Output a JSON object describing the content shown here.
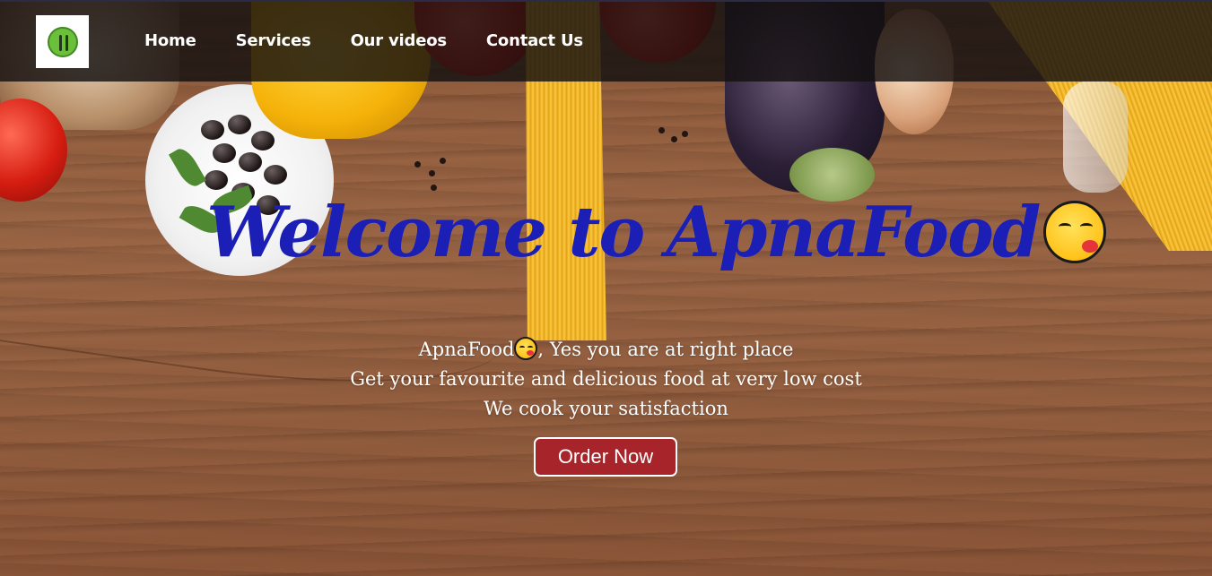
{
  "nav": {
    "logo": "logo-icon",
    "links": [
      "Home",
      "Services",
      "Our videos",
      "Contact Us"
    ]
  },
  "hero": {
    "title": "Welcome to ApnaFood",
    "title_emoji": "face-savoring-food-emoji",
    "line1_a": "ApnaFood",
    "line1_b": ", Yes you are at right place",
    "line2": "Get your favourite and delicious food at very low cost",
    "line3": "We cook your satisfaction",
    "cta": "Order Now"
  },
  "colors": {
    "title": "#1c1fb5",
    "button": "#a6242a",
    "navbar": "#141010",
    "wood": "#935f40"
  }
}
